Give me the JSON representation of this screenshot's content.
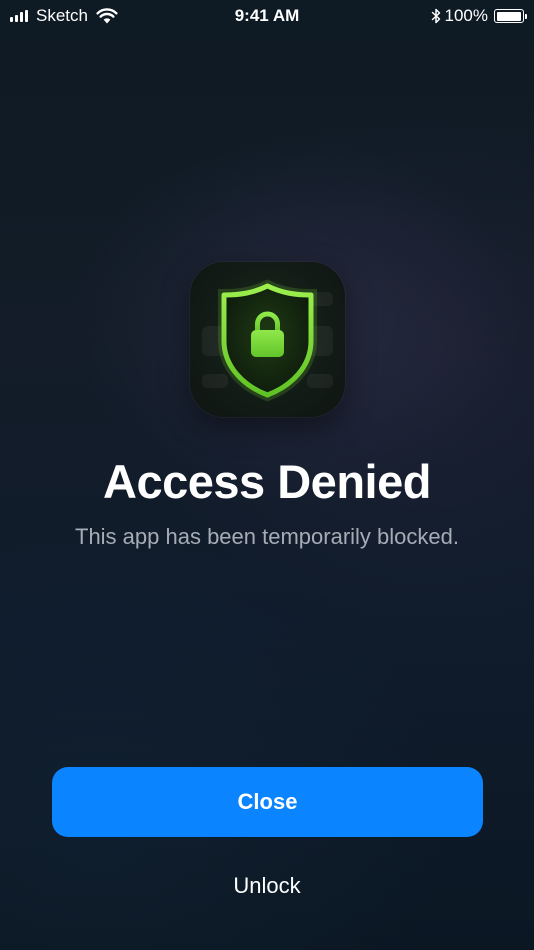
{
  "status_bar": {
    "carrier": "Sketch",
    "time": "9:41 AM",
    "battery_percent": "100%",
    "battery_level": 1.0,
    "signal_bars": 4,
    "icons": [
      "signal-icon",
      "wifi-icon",
      "bluetooth-icon",
      "battery-icon"
    ]
  },
  "app_icon": {
    "icon": "shield-lock-icon",
    "accent_color": "#7ee13a",
    "background_color": "#121b16"
  },
  "message": {
    "title": "Access Denied",
    "subtitle": "This app has been temporarily blocked."
  },
  "actions": {
    "close_label": "Close",
    "unlock_label": "Unlock",
    "primary_color": "#0a84ff"
  },
  "colors": {
    "background": "#111b27",
    "subtitle_text": "#a6acb6"
  }
}
